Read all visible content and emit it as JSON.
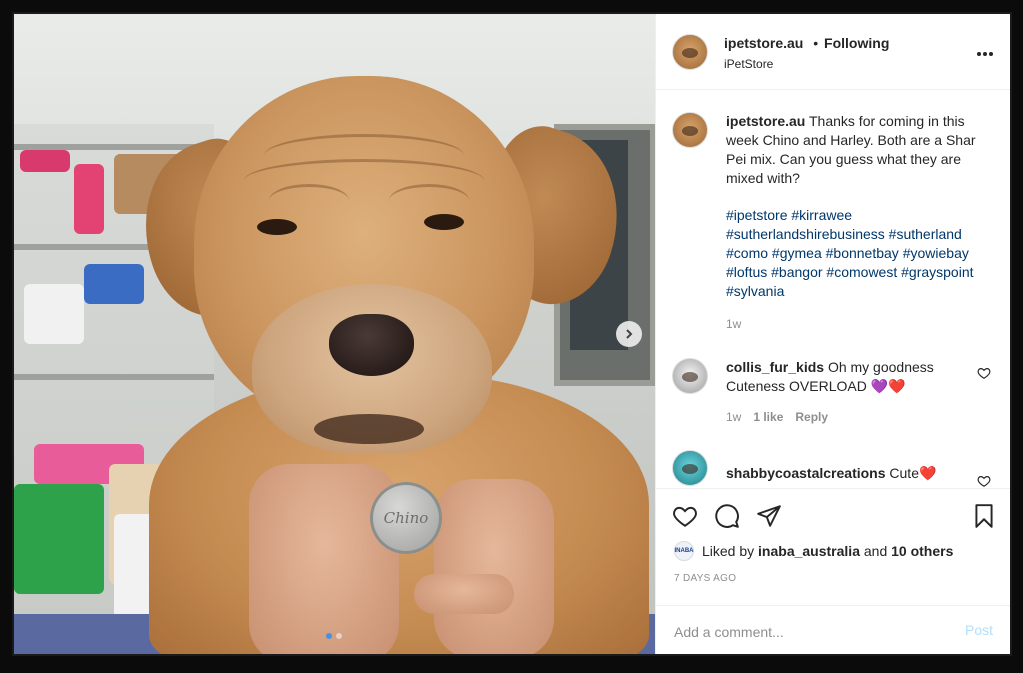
{
  "post": {
    "author": "ipetstore.au",
    "follow_status": "Following",
    "separator": "•",
    "subtitle": "iPetStore",
    "more_icon": "more-horizontal-icon",
    "tag_text": "Chino",
    "carousel": {
      "slides": 2,
      "current": 1
    }
  },
  "caption": {
    "username": "ipetstore.au",
    "text": "Thanks for coming in this week Chino and Harley. Both are a Shar Pei mix. Can you guess what they are mixed with?",
    "hashtags": [
      "#ipetstore",
      "#kirrawee",
      "#sutherlandshirebusiness",
      "#sutherland",
      "#como",
      "#gymea",
      "#bonnetbay",
      "#yowiebay",
      "#loftus",
      "#bangor",
      "#comowest",
      "#grayspoint",
      "#sylvania"
    ],
    "time": "1w"
  },
  "comments": [
    {
      "username": "collis_fur_kids",
      "text": "Oh my goodness Cuteness OVERLOAD",
      "emoji": "💜❤️",
      "time": "1w",
      "likes": "1 like",
      "reply": "Reply"
    },
    {
      "username": "shabbycoastalcreations",
      "text": "Cute",
      "emoji": "❤️"
    }
  ],
  "likes": {
    "prefix": "Liked by",
    "user": "inaba_australia",
    "and": "and",
    "others": "10 others",
    "mini_avatar_label": "INABA"
  },
  "date": "7 DAYS AGO",
  "add_comment": {
    "placeholder": "Add a comment...",
    "post_label": "Post"
  },
  "colors": {
    "hashtag": "#00376b",
    "post_disabled": "#b2dffc",
    "heart_red": "#ed4956"
  }
}
